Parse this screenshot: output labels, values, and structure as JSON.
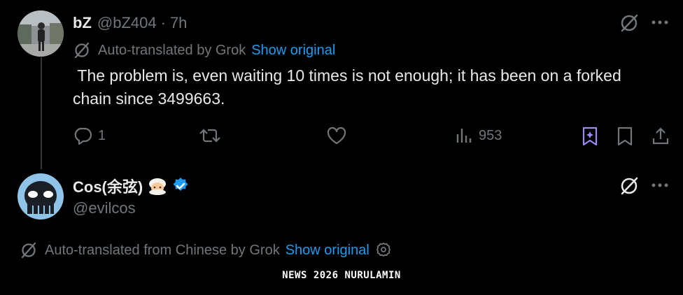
{
  "tweet1": {
    "display_name": "bZ",
    "handle": "@bZ404",
    "separator": "·",
    "time": "7h",
    "translation_label": "Auto-translated by Grok",
    "show_original": "Show original",
    "text": " The problem is, even waiting 10 times is not enough; it has been on a forked chain since 3499663.",
    "actions": {
      "reply_count": "1",
      "retweet_count": "",
      "like_count": "",
      "views_count": "953"
    }
  },
  "tweet2": {
    "display_name": "Cos(余弦)",
    "handle": "@evilcos",
    "translation_label": "Auto-translated from Chinese by Grok",
    "show_original": "Show original"
  },
  "watermark": "NEWS 2026 NURULAMIN",
  "colors": {
    "background": "#000000",
    "text": "#e7e9ea",
    "muted": "#71767b",
    "accent": "#1d9bf0",
    "bookmark_purple": "#9b8cf5"
  },
  "icons": [
    "grok-icon",
    "more-icon",
    "reply-icon",
    "retweet-icon",
    "like-icon",
    "views-icon",
    "grok-bookmark-icon",
    "bookmark-icon",
    "share-icon",
    "verified-icon",
    "gear-icon"
  ]
}
